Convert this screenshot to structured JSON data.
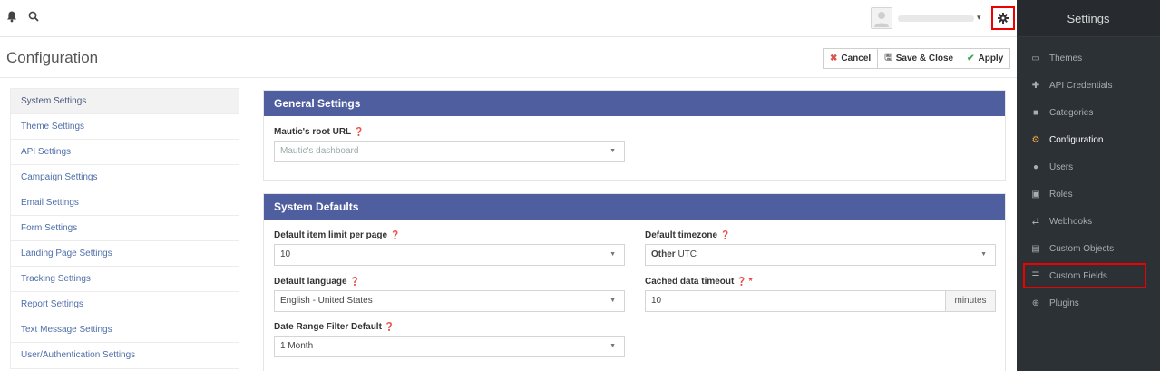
{
  "topbar": {
    "bell_icon": "bell-icon",
    "search_icon": "search-icon",
    "user_caret": "▾",
    "settings_icon": "gear-icon"
  },
  "header": {
    "title": "Configuration",
    "cancel_label": "Cancel",
    "save_close_label": "Save & Close",
    "apply_label": "Apply",
    "cancel_icon": "✖",
    "save_icon": "🖫",
    "apply_icon": "✔"
  },
  "nav": {
    "items": [
      "System Settings",
      "Theme Settings",
      "API Settings",
      "Campaign Settings",
      "Email Settings",
      "Form Settings",
      "Landing Page Settings",
      "Tracking Settings",
      "Report Settings",
      "Text Message Settings",
      "User/Authentication Settings"
    ]
  },
  "general": {
    "title": "General Settings",
    "root_url_label": "Mautic's root URL",
    "root_url_placeholder": "Mautic's dashboard"
  },
  "defaults": {
    "title": "System Defaults",
    "item_limit_label": "Default item limit per page",
    "item_limit_value": "10",
    "timezone_label": "Default timezone",
    "timezone_group": "Other",
    "timezone_value": "UTC",
    "language_label": "Default language",
    "language_value": "English - United States",
    "cache_label": "Cached data timeout",
    "cache_value": "10",
    "cache_unit": "minutes",
    "date_range_label": "Date Range Filter Default",
    "date_range_value": "1 Month"
  },
  "sidebar": {
    "title": "Settings",
    "items": [
      {
        "label": "Themes",
        "icon": "themes-icon"
      },
      {
        "label": "API Credentials",
        "icon": "puzzle-icon"
      },
      {
        "label": "Categories",
        "icon": "folder-icon"
      },
      {
        "label": "Configuration",
        "icon": "cogs-icon"
      },
      {
        "label": "Users",
        "icon": "users-icon"
      },
      {
        "label": "Roles",
        "icon": "lock-icon"
      },
      {
        "label": "Webhooks",
        "icon": "exchange-icon"
      },
      {
        "label": "Custom Objects",
        "icon": "list-alt-icon"
      },
      {
        "label": "Custom Fields",
        "icon": "list-icon"
      },
      {
        "label": "Plugins",
        "icon": "plus-circle-icon"
      }
    ]
  },
  "colors": {
    "panel_header": "#4e5e9e",
    "sidebar_bg": "#2c3136",
    "active_icon": "#f2a93b",
    "highlight": "#ee0000"
  }
}
